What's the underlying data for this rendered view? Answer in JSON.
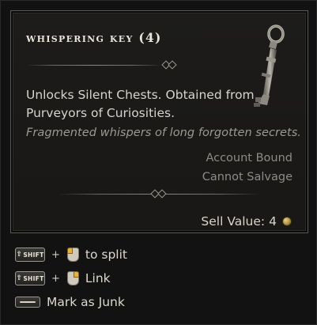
{
  "item": {
    "name": "Whispering Key (4)",
    "icon": "whispering-key-icon",
    "description": "Unlocks Silent Chests. Obtained from Purveyors of Curiosities.",
    "flavor": "Fragmented whispers of long forgotten secrets.",
    "tags": [
      "Account Bound",
      "Cannot Salvage"
    ],
    "sell_label": "Sell Value:",
    "sell_value": "4",
    "currency_icon": "gold-coin-icon"
  },
  "controls": [
    {
      "modifier_key": "SHIFT",
      "mouse": "left-click-icon",
      "action": "to split"
    },
    {
      "modifier_key": "SHIFT",
      "mouse": "right-click-icon",
      "action": "Link"
    },
    {
      "key": "spacebar-icon",
      "action": "Mark as Junk"
    }
  ],
  "colors": {
    "panel_bg": "#1a1917",
    "text": "#d7d4cc",
    "muted": "#8e8b84",
    "highlight": "#e6b33a"
  }
}
